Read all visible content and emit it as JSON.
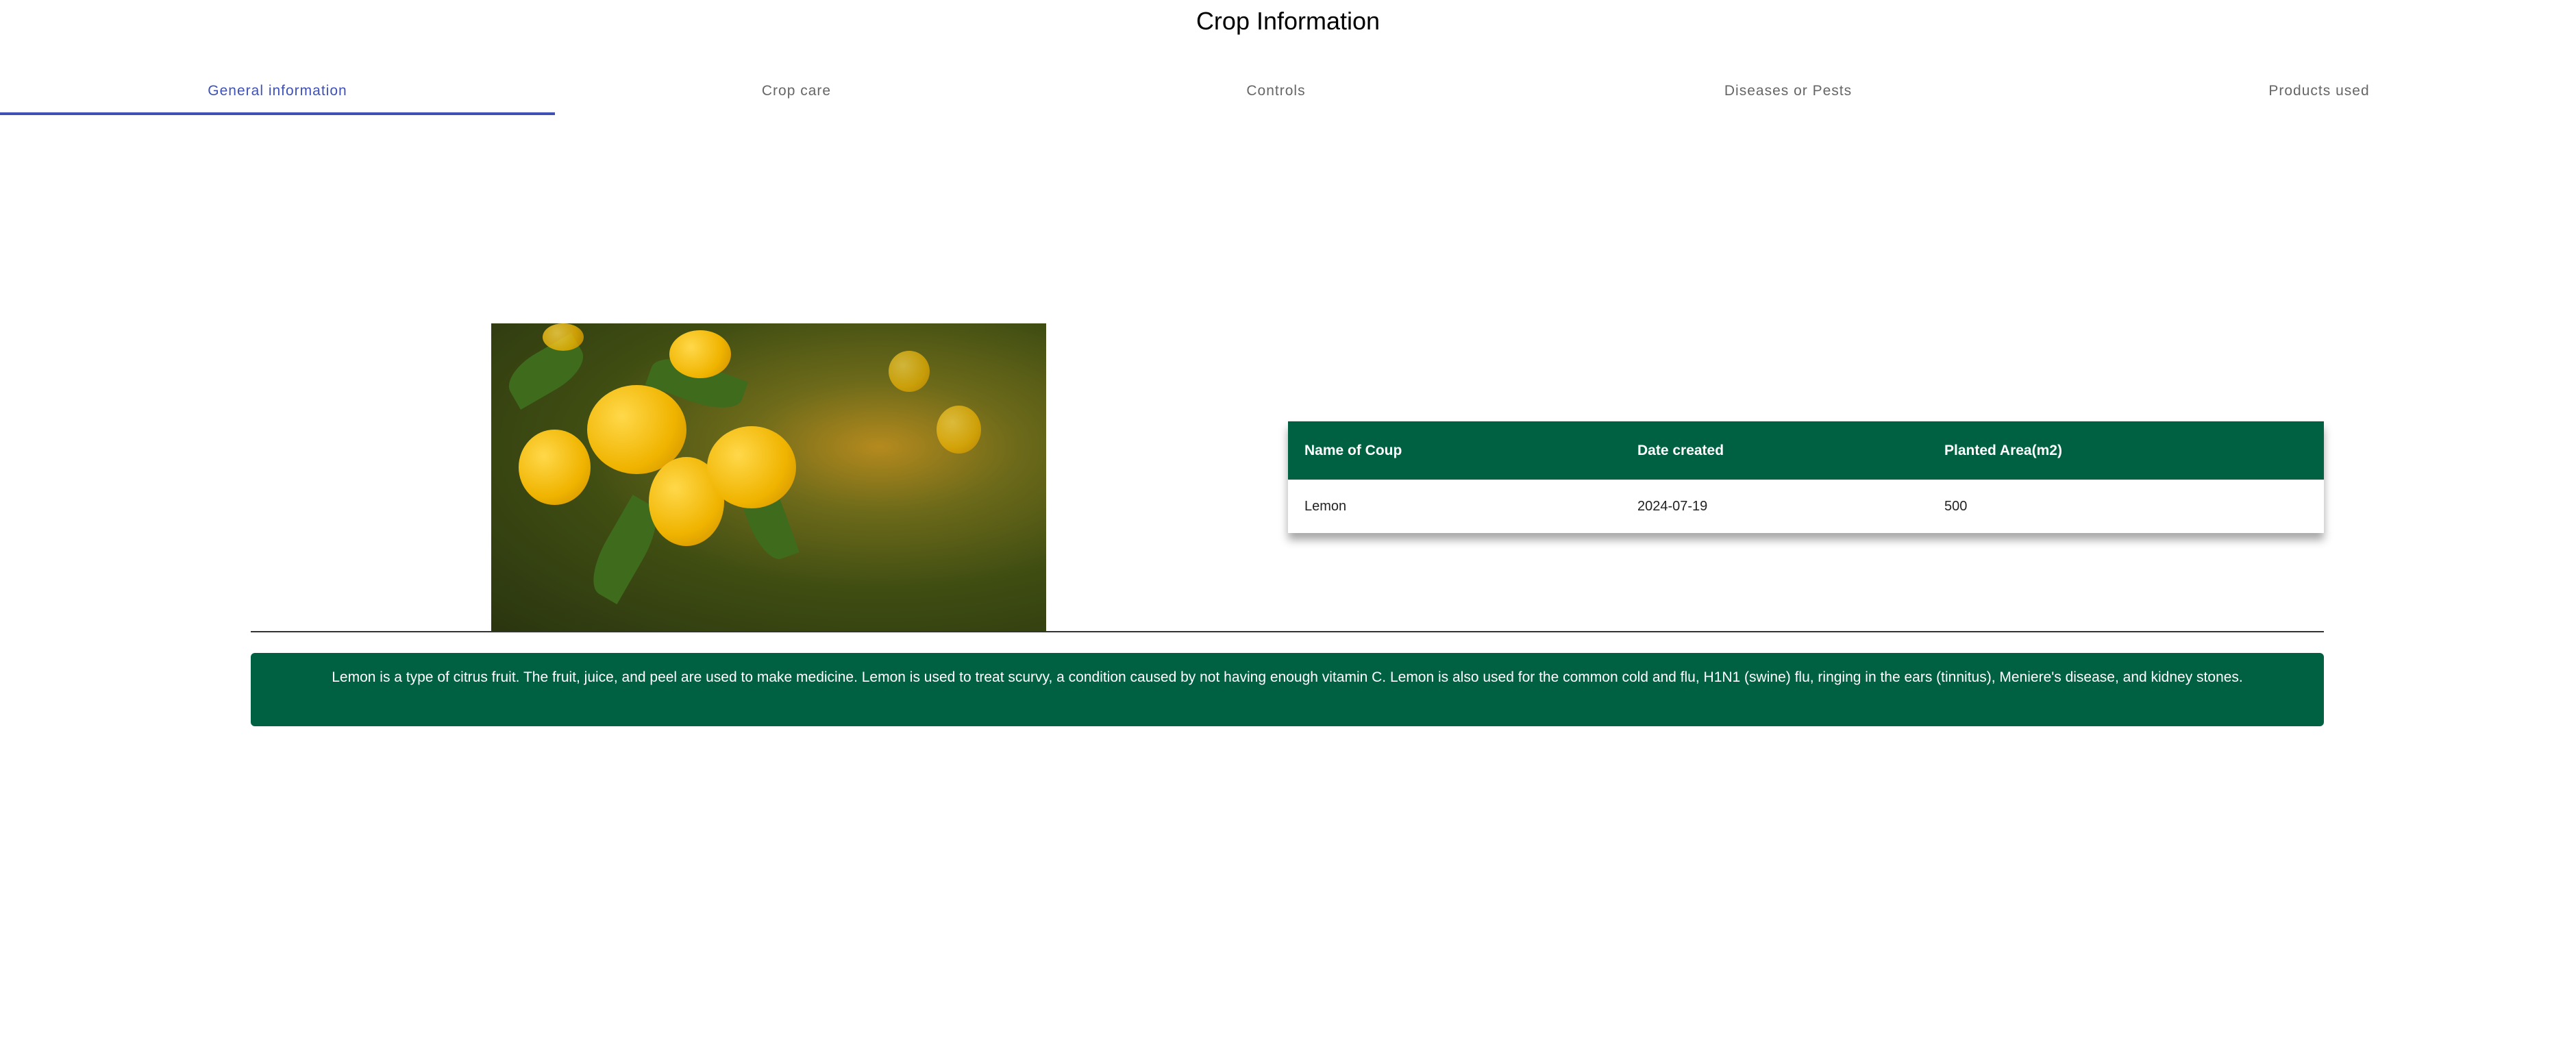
{
  "header": {
    "title": "Crop Information"
  },
  "tabs": [
    {
      "label": "General information",
      "active": true
    },
    {
      "label": "Crop care"
    },
    {
      "label": "Controls"
    },
    {
      "label": "Diseases or Pests"
    },
    {
      "label": "Products used"
    }
  ],
  "table": {
    "headers": [
      "Name of Coup",
      "Date created",
      "Planted Area(m2)"
    ],
    "rows": [
      [
        "Lemon",
        "2024-07-19",
        "500"
      ]
    ]
  },
  "description": "Lemon is a type of citrus fruit. The fruit, juice, and peel are used to make medicine. Lemon is used to treat scurvy, a condition caused by not having enough vitamin C. Lemon is also used for the common cold and flu, H1N1 (swine) flu, ringing in the ears (tinnitus), Meniere's disease, and kidney stones.",
  "colors": {
    "accent": "#3f51b5",
    "brand_green": "#006142"
  }
}
